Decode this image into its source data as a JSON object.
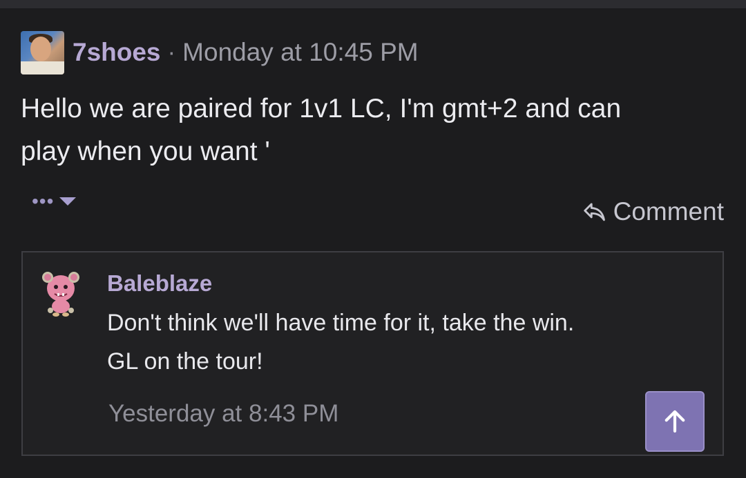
{
  "post": {
    "author": "7shoes",
    "separator": "·",
    "timestamp": "Monday at 10:45 PM",
    "body_line1": "Hello we are paired for 1v1 LC, I'm gmt+2 and can",
    "body_line2": "play when you want '",
    "more_label": "•••",
    "comment_label": "Comment"
  },
  "reply": {
    "author": "Baleblaze",
    "line1": "Don't think we'll have time for it, take the win.",
    "line2": "GL on the tour!",
    "timestamp": "Yesterday at 8:43 PM"
  },
  "icons": {
    "comment": "reply-arrow-icon",
    "scroll_top": "arrow-up-icon",
    "more": "ellipsis-icon",
    "caret": "caret-down-icon"
  },
  "colors": {
    "background": "#1c1c1e",
    "accent": "#b7a9d4",
    "button": "#7e73b2"
  }
}
